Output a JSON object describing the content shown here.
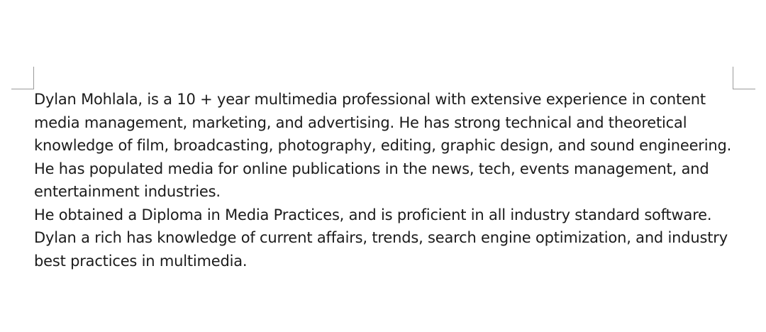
{
  "document": {
    "paragraphs": [
      "Dylan Mohlala, is a 10 + year multimedia professional with extensive experience in content media management, marketing, and advertising. He has strong technical and theoretical knowledge of film, broadcasting, photography, editing, graphic design, and sound engineering.",
      "He has populated media for online publications in the news, tech, events management, and entertainment industries.",
      "He obtained a Diploma in Media Practices, and is proficient in all industry standard software.",
      "Dylan a rich has knowledge of current affairs, trends, search engine optimization, and industry best practices in multimedia."
    ]
  }
}
